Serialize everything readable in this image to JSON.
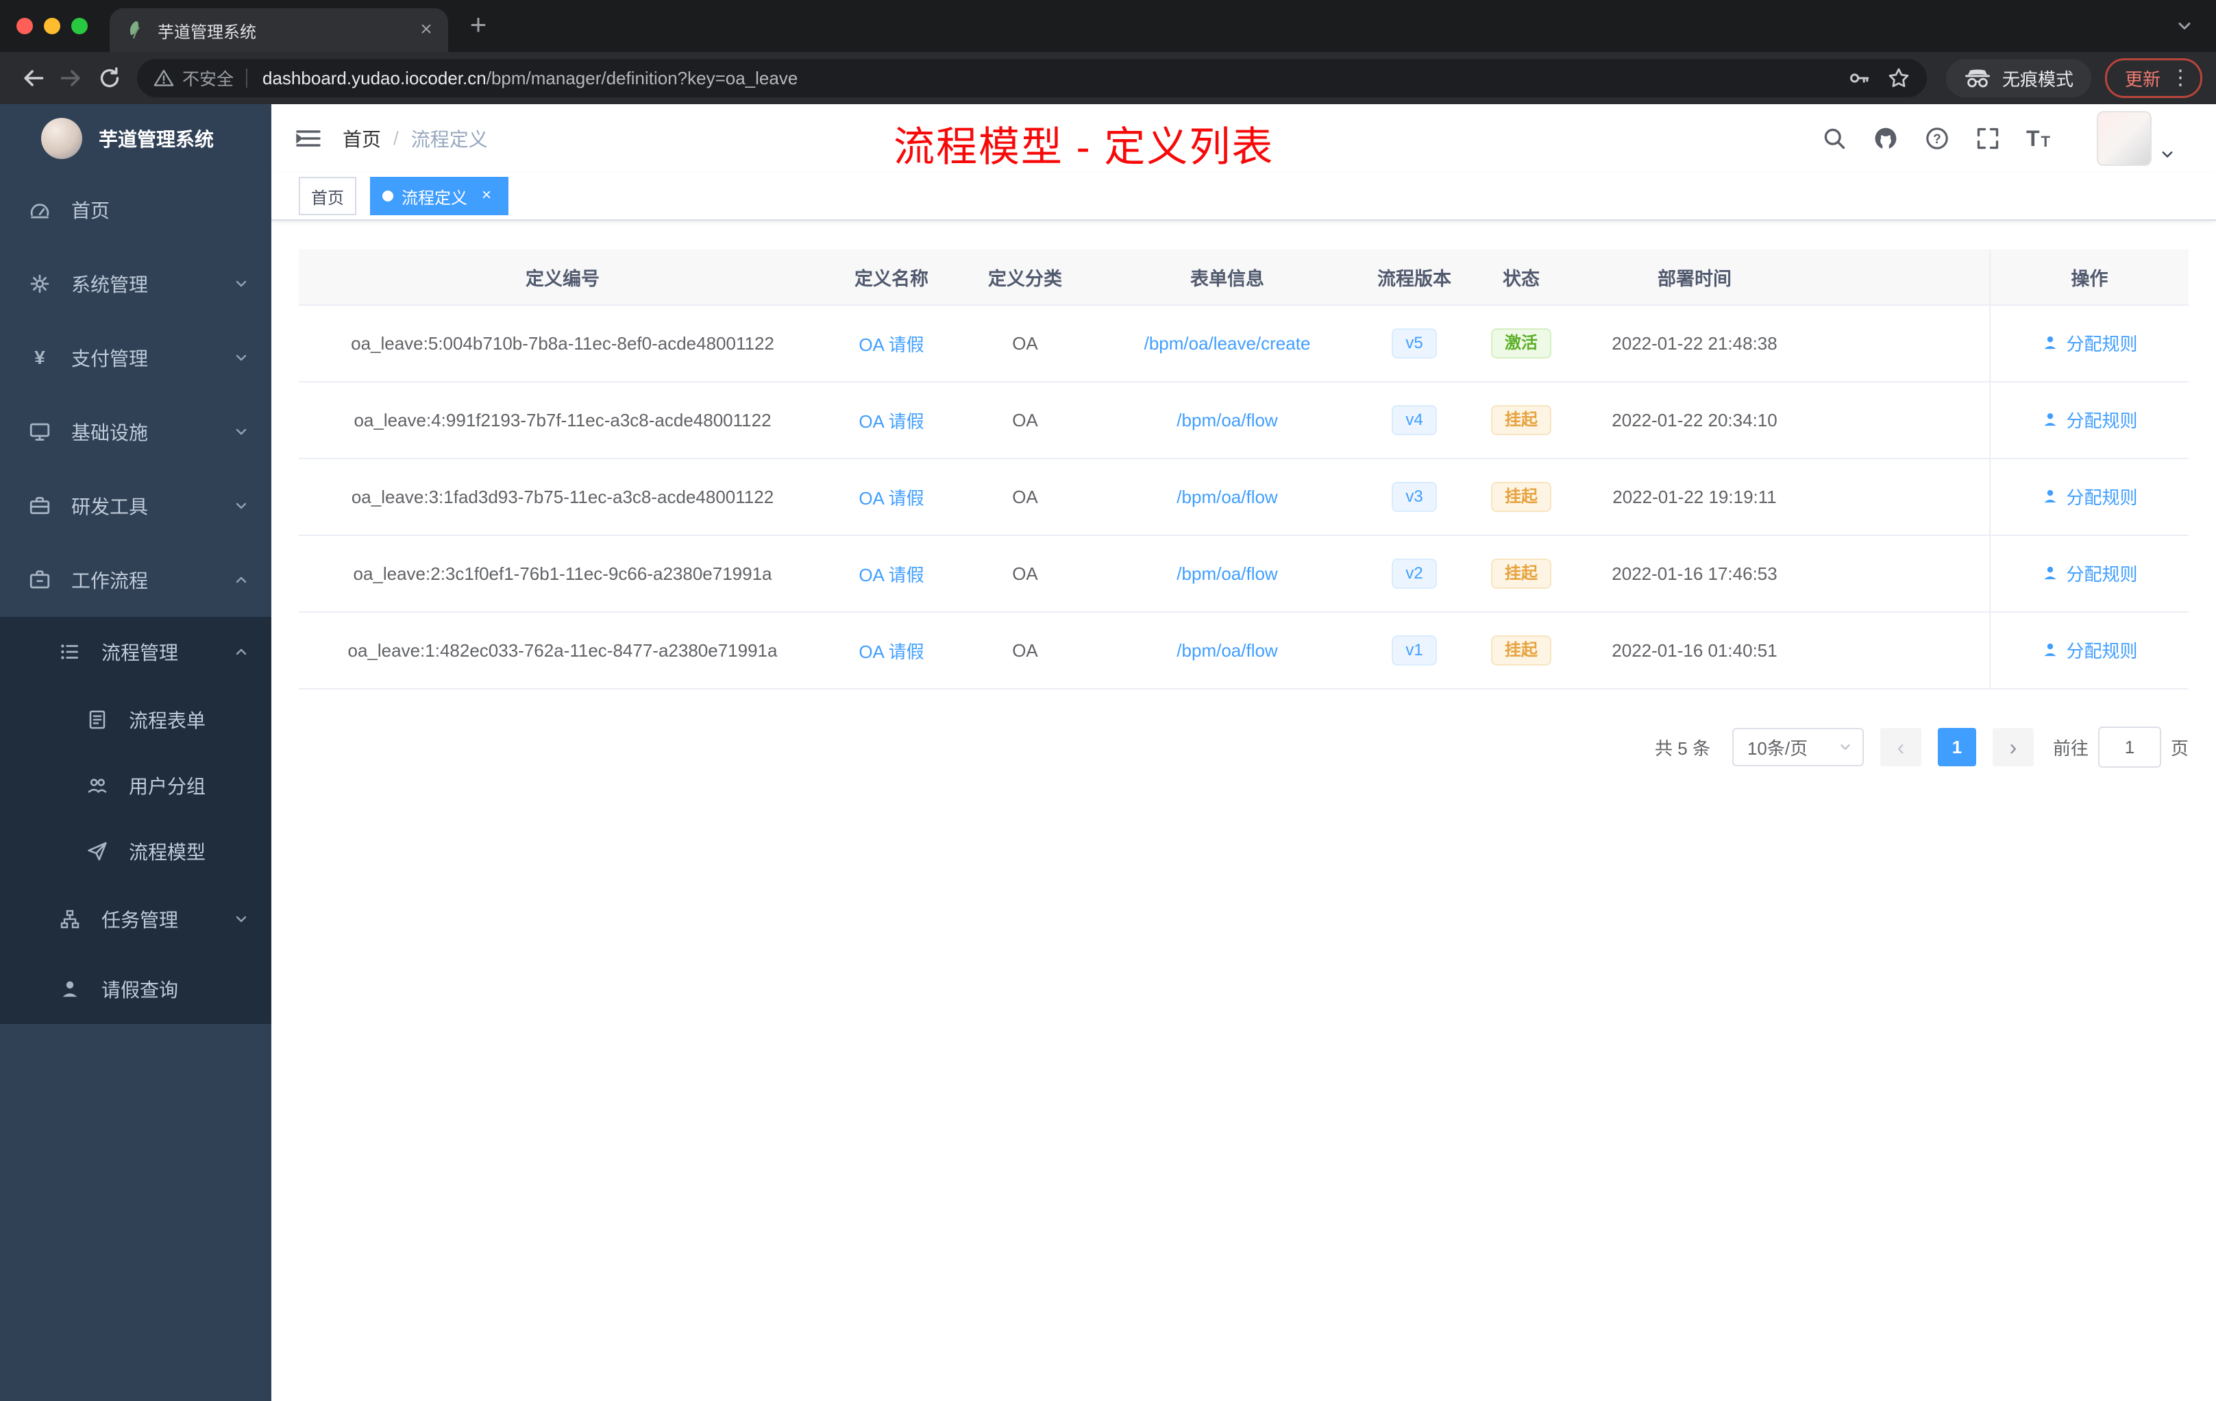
{
  "colors": {
    "accent": "#409eff",
    "annotation_red": "#f70909",
    "status_active_green": "#67c23a",
    "status_suspended_orange": "#e6a23c",
    "sidebar_bg": "#304156",
    "submenu_bg": "#1f2d3d"
  },
  "browser": {
    "tab_title": "芋道管理系统",
    "address": {
      "security": "不安全",
      "host": "dashboard.yudao.iocoder.cn",
      "path": "/bpm/manager/definition?key=oa_leave"
    },
    "incognito_label": "无痕模式",
    "update_label": "更新"
  },
  "icons": {
    "tab_close": "×",
    "new_tab": "+",
    "menu_kebab": "⋮",
    "tag_close": "×",
    "prev_arrow": "‹",
    "next_arrow": "›",
    "yen": "¥",
    "question_mark": "?",
    "font_large": "T",
    "font_small": "T"
  },
  "sidebar": {
    "app_title": "芋道管理系统",
    "items": [
      {
        "label": "首页",
        "icon": "dashboard-icon"
      },
      {
        "label": "系统管理",
        "icon": "gear-icon"
      },
      {
        "label": "支付管理",
        "icon": "yen-icon"
      },
      {
        "label": "基础设施",
        "icon": "monitor-icon"
      },
      {
        "label": "研发工具",
        "icon": "toolbox-icon"
      },
      {
        "label": "工作流程",
        "icon": "briefcase-icon"
      },
      {
        "label": "流程管理",
        "icon": "process-list-icon"
      },
      {
        "label": "流程表单",
        "icon": "form-icon"
      },
      {
        "label": "用户分组",
        "icon": "user-group-icon"
      },
      {
        "label": "流程模型",
        "icon": "paper-plane-icon"
      },
      {
        "label": "任务管理",
        "icon": "org-chart-icon"
      },
      {
        "label": "请假查询",
        "icon": "person-icon"
      }
    ]
  },
  "header": {
    "breadcrumb": [
      "首页",
      "流程定义"
    ],
    "breadcrumb_separator": "/",
    "annotation": "流程模型 - 定义列表"
  },
  "tags": [
    {
      "label": "首页",
      "active": false
    },
    {
      "label": "流程定义",
      "active": true
    }
  ],
  "table": {
    "columns": [
      "定义编号",
      "定义名称",
      "定义分类",
      "表单信息",
      "流程版本",
      "状态",
      "部署时间",
      "操作"
    ],
    "action_label": "分配规则",
    "rows": [
      {
        "id": "oa_leave:5:004b710b-7b8a-11ec-8ef0-acde48001122",
        "name": "OA 请假",
        "category": "OA",
        "form": "/bpm/oa/leave/create",
        "version": "v5",
        "status": "激活",
        "status_type": "success",
        "time": "2022-01-22 21:48:38"
      },
      {
        "id": "oa_leave:4:991f2193-7b7f-11ec-a3c8-acde48001122",
        "name": "OA 请假",
        "category": "OA",
        "form": "/bpm/oa/flow",
        "version": "v4",
        "status": "挂起",
        "status_type": "warning",
        "time": "2022-01-22 20:34:10"
      },
      {
        "id": "oa_leave:3:1fad3d93-7b75-11ec-a3c8-acde48001122",
        "name": "OA 请假",
        "category": "OA",
        "form": "/bpm/oa/flow",
        "version": "v3",
        "status": "挂起",
        "status_type": "warning",
        "time": "2022-01-22 19:19:11"
      },
      {
        "id": "oa_leave:2:3c1f0ef1-76b1-11ec-9c66-a2380e71991a",
        "name": "OA 请假",
        "category": "OA",
        "form": "/bpm/oa/flow",
        "version": "v2",
        "status": "挂起",
        "status_type": "warning",
        "time": "2022-01-16 17:46:53"
      },
      {
        "id": "oa_leave:1:482ec033-762a-11ec-8477-a2380e71991a",
        "name": "OA 请假",
        "category": "OA",
        "form": "/bpm/oa/flow",
        "version": "v1",
        "status": "挂起",
        "status_type": "warning",
        "time": "2022-01-16 01:40:51"
      }
    ]
  },
  "pagination": {
    "total": "共 5 条",
    "page_size": "10条/页",
    "current_page": "1",
    "goto_prefix": "前往",
    "goto_value": "1",
    "goto_suffix": "页"
  }
}
